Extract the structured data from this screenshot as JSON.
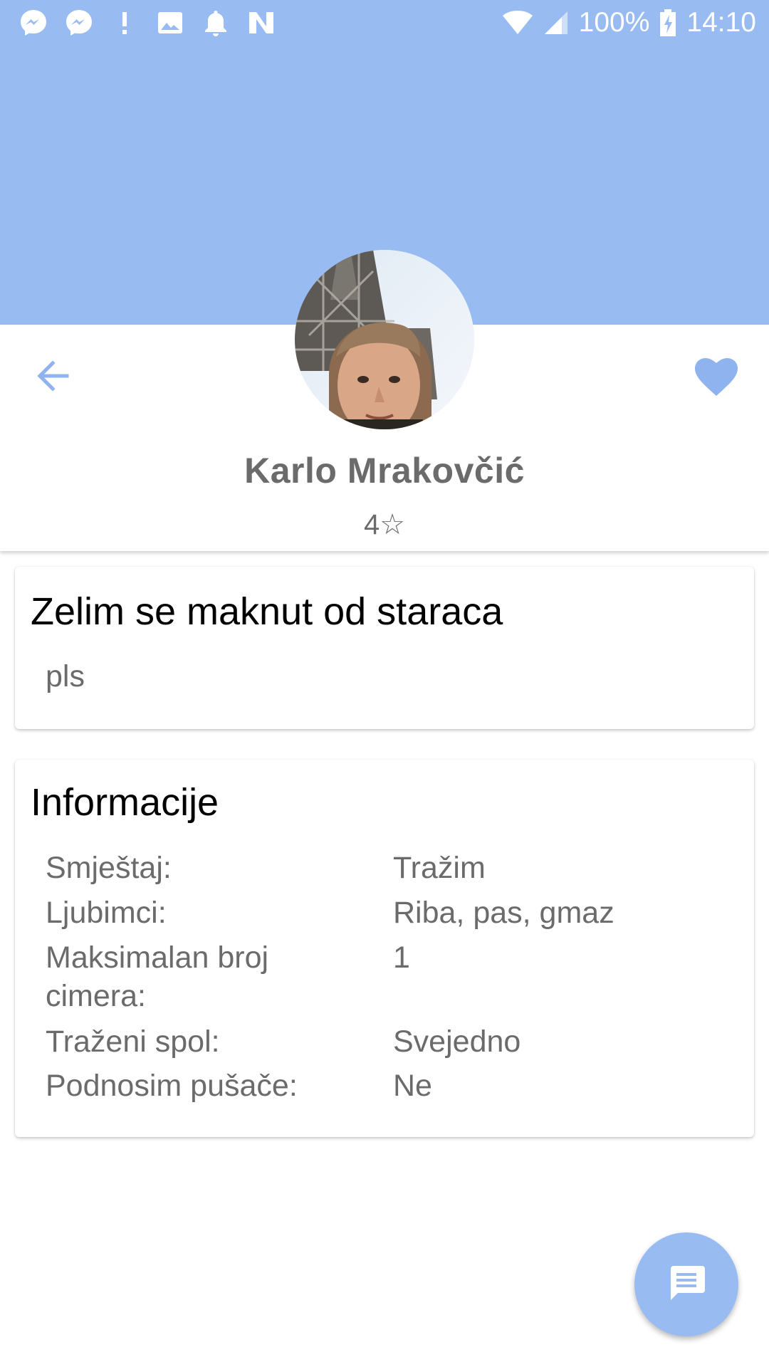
{
  "theme": {
    "accent": "#98bbf2",
    "icon_blue": "#8fb3ee",
    "text_gray": "#6b6b6b"
  },
  "status_bar": {
    "battery": "100%",
    "time": "14:10",
    "icons": [
      "messenger-icon",
      "messenger-icon",
      "alert-icon",
      "image-icon",
      "notification-bell-icon",
      "nfc-icon",
      "wifi-icon",
      "signal-icon",
      "battery-charging-icon"
    ]
  },
  "profile": {
    "name": "Karlo Mrakovčić",
    "rating": "4☆"
  },
  "post": {
    "title": "Zelim se maknut od staraca",
    "body": "pls"
  },
  "info": {
    "title": "Informacije",
    "rows": [
      {
        "label": "Smještaj:",
        "value": "Tražim"
      },
      {
        "label": "Ljubimci:",
        "value": "Riba, pas, gmaz"
      },
      {
        "label": "Maksimalan broj cimera:",
        "value": "1"
      },
      {
        "label": "Traženi spol:",
        "value": "Svejedno"
      },
      {
        "label": "Podnosim pušače:",
        "value": "Ne"
      }
    ]
  }
}
